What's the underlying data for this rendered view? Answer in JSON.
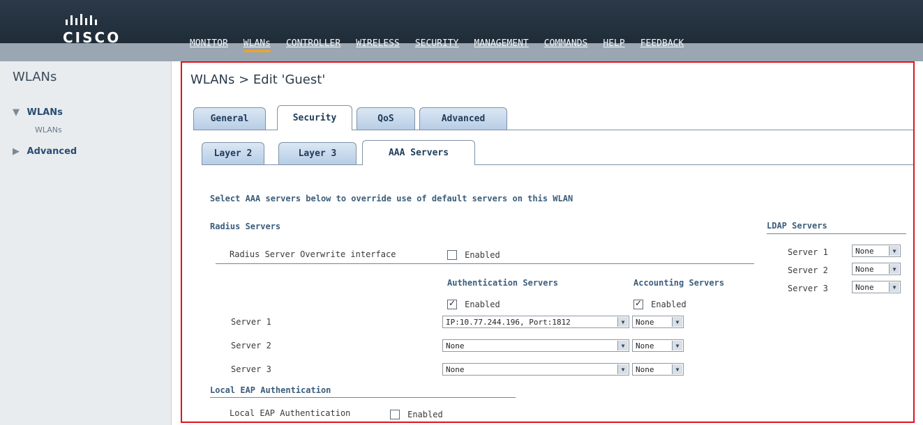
{
  "brand": {
    "name": "CISCO"
  },
  "nav": {
    "items": [
      "MONITOR",
      "WLANs",
      "CONTROLLER",
      "WIRELESS",
      "SECURITY",
      "MANAGEMENT",
      "COMMANDS",
      "HELP",
      "FEEDBACK"
    ],
    "active": "WLANs"
  },
  "left": {
    "title": "WLANs",
    "tree": {
      "wlans": "WLANs",
      "wlans_sub": "WLANs",
      "advanced": "Advanced"
    }
  },
  "page": {
    "title": "WLANs > Edit  'Guest'"
  },
  "tabs_primary": [
    "General",
    "Security",
    "QoS",
    "Advanced"
  ],
  "tabs_secondary": [
    "Layer 2",
    "Layer 3",
    "AAA Servers"
  ],
  "aaa": {
    "intro": "Select AAA servers below to override use of default servers on this WLAN",
    "radius_title": "Radius Servers",
    "radius_overwrite_label": "Radius Server Overwrite interface",
    "enabled": "Enabled",
    "auth_header": "Authentication Servers",
    "acct_header": "Accounting Servers",
    "servers": [
      {
        "label": "Server 1",
        "auth": "IP:10.77.244.196, Port:1812",
        "acct": "None"
      },
      {
        "label": "Server 2",
        "auth": "None",
        "acct": "None"
      },
      {
        "label": "Server 3",
        "auth": "None",
        "acct": "None"
      }
    ],
    "local_eap_title": "Local EAP Authentication",
    "local_eap_label": "Local EAP Authentication"
  },
  "ldap": {
    "title": "LDAP Servers",
    "servers": [
      {
        "label": "Server 1",
        "value": "None"
      },
      {
        "label": "Server 2",
        "value": "None"
      },
      {
        "label": "Server 3",
        "value": "None"
      }
    ]
  },
  "colors": {
    "frame_red": "#e0131b",
    "active_nav": "#f7a21b"
  }
}
